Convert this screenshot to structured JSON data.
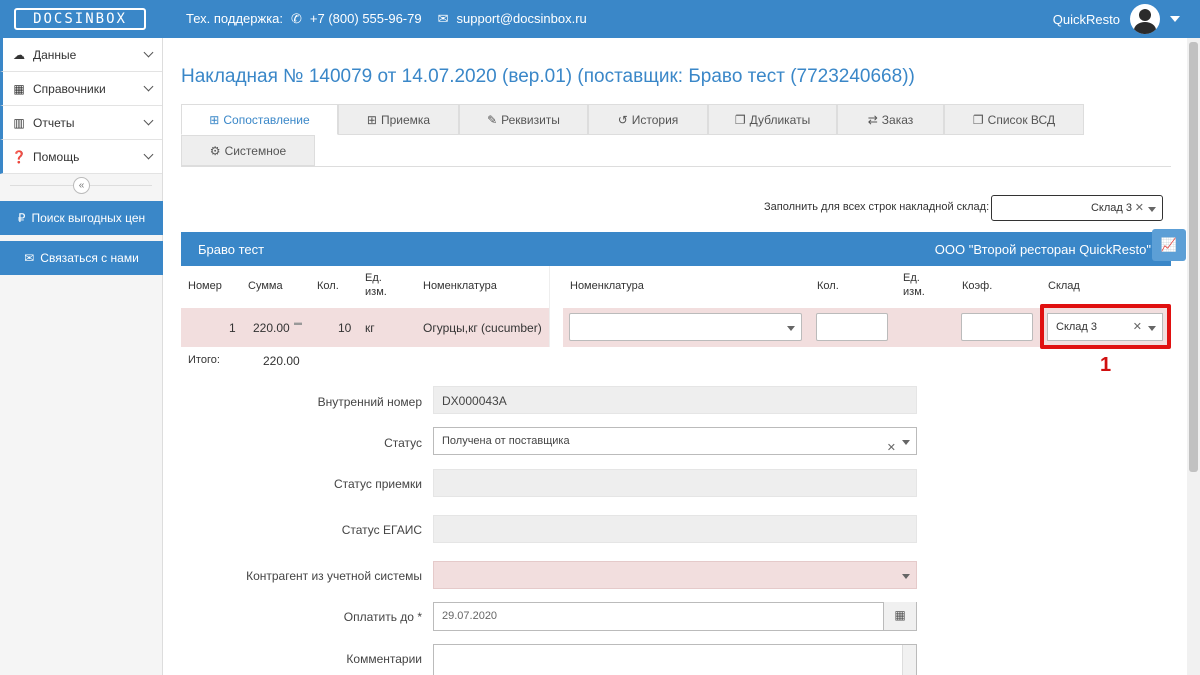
{
  "header": {
    "logo": "DOCSINBOX",
    "support_label": "Тех. поддержка:",
    "phone": "+7 (800) 555-96-79",
    "email": "support@docsinbox.ru",
    "user": "QuickResto"
  },
  "sidebar": {
    "items": [
      {
        "label": "Данные",
        "icon": "cloud-icon"
      },
      {
        "label": "Справочники",
        "icon": "table-icon"
      },
      {
        "label": "Отчеты",
        "icon": "bar-chart-icon"
      },
      {
        "label": "Помощь",
        "icon": "question-icon"
      }
    ],
    "price_search": "Поиск выгодных цен",
    "contact": "Связаться с нами"
  },
  "page": {
    "title": "Накладная № 140079 от 14.07.2020 (вер.01) (поставщик: Браво тест (7723240668))"
  },
  "tabs": [
    {
      "label": "Сопоставление",
      "icon": "⊞"
    },
    {
      "label": "Приемка",
      "icon": "⊞"
    },
    {
      "label": "Реквизиты",
      "icon": "✎"
    },
    {
      "label": "История",
      "icon": "↺"
    },
    {
      "label": "Дубликаты",
      "icon": "❐"
    },
    {
      "label": "Заказ",
      "icon": "⇄"
    },
    {
      "label": "Список ВСД",
      "icon": "❐"
    },
    {
      "label": "Системное",
      "icon": "⚙"
    }
  ],
  "fill_warehouse": {
    "label": "Заполнить для всех строк накладной склад:",
    "value": "Склад 3"
  },
  "band": {
    "supplier": "Браво тест",
    "buyer": "ООО \"Второй ресторан QuickResto\""
  },
  "table": {
    "headers_left": [
      "Номер",
      "Сумма",
      "Кол.",
      "Ед. изм.",
      "Номенклатура"
    ],
    "headers_right": [
      "Номенклатура",
      "Кол.",
      "Ед. изм.",
      "Коэф.",
      "Склад"
    ],
    "row": {
      "number": "1",
      "sum": "220.00",
      "qty": "10",
      "unit": "кг",
      "nomenclature": "Огурцы,кг (cucumber)",
      "warehouse": "Склад 3"
    },
    "total_label": "Итого:",
    "total_value": "220.00"
  },
  "annotation": {
    "marker": "1"
  },
  "form": {
    "internal_number_label": "Внутренний номер",
    "internal_number": "DX000043A",
    "status_label": "Статус",
    "status": "Получена от поставщика",
    "receipt_status_label": "Статус приемки",
    "egais_status_label": "Статус ЕГАИС",
    "counterparty_label": "Контрагент из учетной системы",
    "pay_until_label": "Оплатить до *",
    "pay_until": "29.07.2020",
    "comments_label": "Комментарии"
  }
}
